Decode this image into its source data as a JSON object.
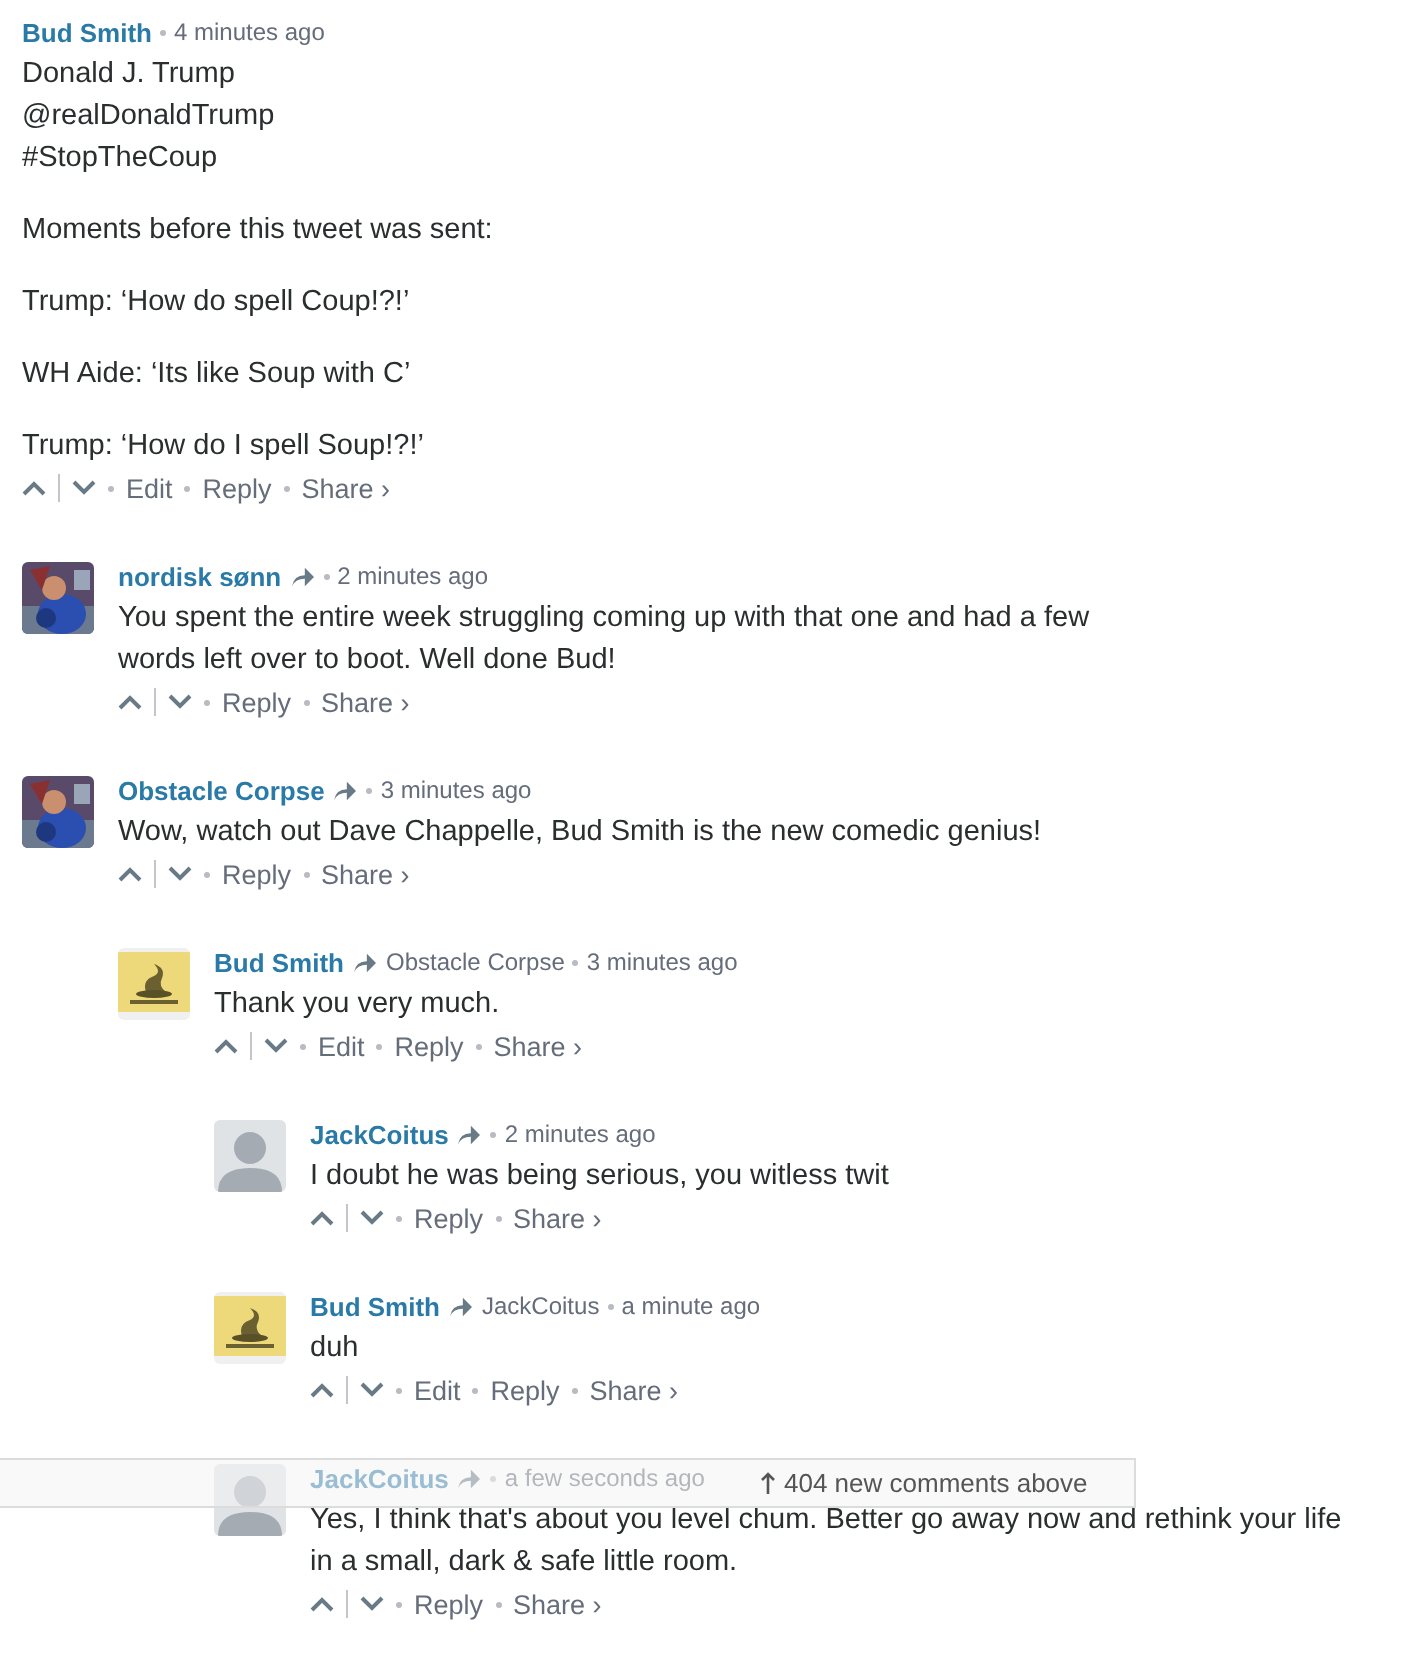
{
  "comments": [
    {
      "author": "Bud Smith",
      "time": "4 minutes ago",
      "body": [
        "Donald J. Trump\n@realDonaldTrump\n#StopTheCoup",
        "Moments before this tweet was sent:",
        "Trump: ‘How do spell Coup!?!’",
        "WH Aide: ‘Its like Soup with C’",
        "Trump: ‘How do I spell Soup!?!’"
      ],
      "actions": [
        "Edit",
        "Reply",
        "Share ›"
      ],
      "children": [
        {
          "author": "nordisk sønn",
          "time": "2 minutes ago",
          "body": [
            "You spent the entire week struggling coming up with that one and had a few words left over to boot. Well done Bud!"
          ],
          "actions": [
            "Reply",
            "Share ›"
          ]
        },
        {
          "author": "Obstacle Corpse",
          "time": "3 minutes ago",
          "body": [
            "Wow, watch out Dave Chappelle, Bud Smith is the new comedic genius!"
          ],
          "actions": [
            "Reply",
            "Share ›"
          ],
          "children": [
            {
              "kind": "flag",
              "author": "Bud Smith",
              "reply_to": "Obstacle Corpse",
              "time": "3 minutes ago",
              "body": [
                "Thank you very much."
              ],
              "actions": [
                "Edit",
                "Reply",
                "Share ›"
              ],
              "children": [
                {
                  "kind": "silhouette",
                  "author": "JackCoitus",
                  "time": "2 minutes ago",
                  "body": [
                    "I doubt he was being serious, you witless twit"
                  ],
                  "actions": [
                    "Reply",
                    "Share ›"
                  ]
                },
                {
                  "kind": "flag",
                  "author": "Bud Smith",
                  "reply_to": "JackCoitus",
                  "time": "a minute ago",
                  "body": [
                    "duh"
                  ],
                  "actions": [
                    "Edit",
                    "Reply",
                    "Share ›"
                  ]
                },
                {
                  "kind": "silhouette",
                  "author": "JackCoitus",
                  "time": "a few seconds ago",
                  "body": [
                    "Yes, I think that's about you level chum. Better go away now and rethink your life in a small, dark & safe little room."
                  ],
                  "actions": [
                    "Reply",
                    "Share ›"
                  ]
                }
              ]
            }
          ]
        }
      ]
    }
  ],
  "new_comments_banner": "404 new comments above"
}
